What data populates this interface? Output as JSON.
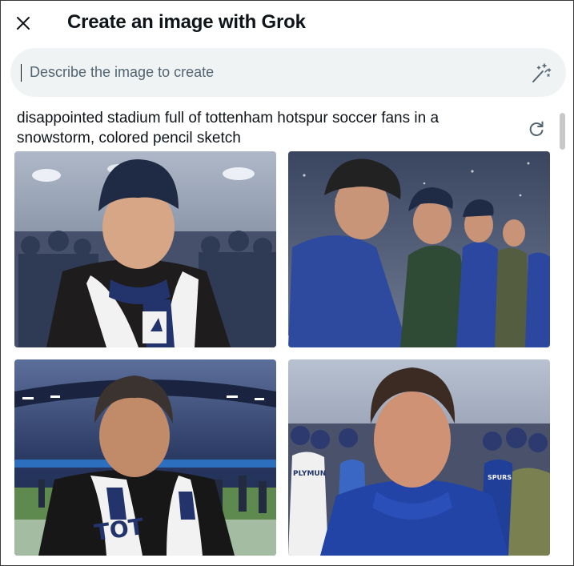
{
  "dialog": {
    "title": "Create an image with Grok",
    "close_icon": "close-icon"
  },
  "search": {
    "placeholder": "Describe the image to create",
    "value": "",
    "action_icon": "magic-wand-icon"
  },
  "result": {
    "prompt": "disappointed stadium full of tottenham hotspur soccer fans in a snowstorm, colored pencil sketch",
    "regenerate_icon": "refresh-icon",
    "images": [
      {
        "name": "generated-image-1",
        "scene": "fan in navy beanie with white-navy scarf, snowy stadium"
      },
      {
        "name": "generated-image-2",
        "scene": "row of fans in blue jackets, snowing stadium"
      },
      {
        "name": "generated-image-3",
        "scene": "fan with scarf on pitch at night stadium"
      },
      {
        "name": "generated-image-4",
        "scene": "close-up fan in blue jacket, crowd behind"
      }
    ],
    "image_text": {
      "scarf_text": "TOT",
      "shirt_text": "PLYMUN",
      "jacket_text": "SPURS"
    }
  },
  "colors": {
    "accent": "#0f1419",
    "search_bg": "#eff3f4",
    "navy": "#1c2a5e"
  }
}
